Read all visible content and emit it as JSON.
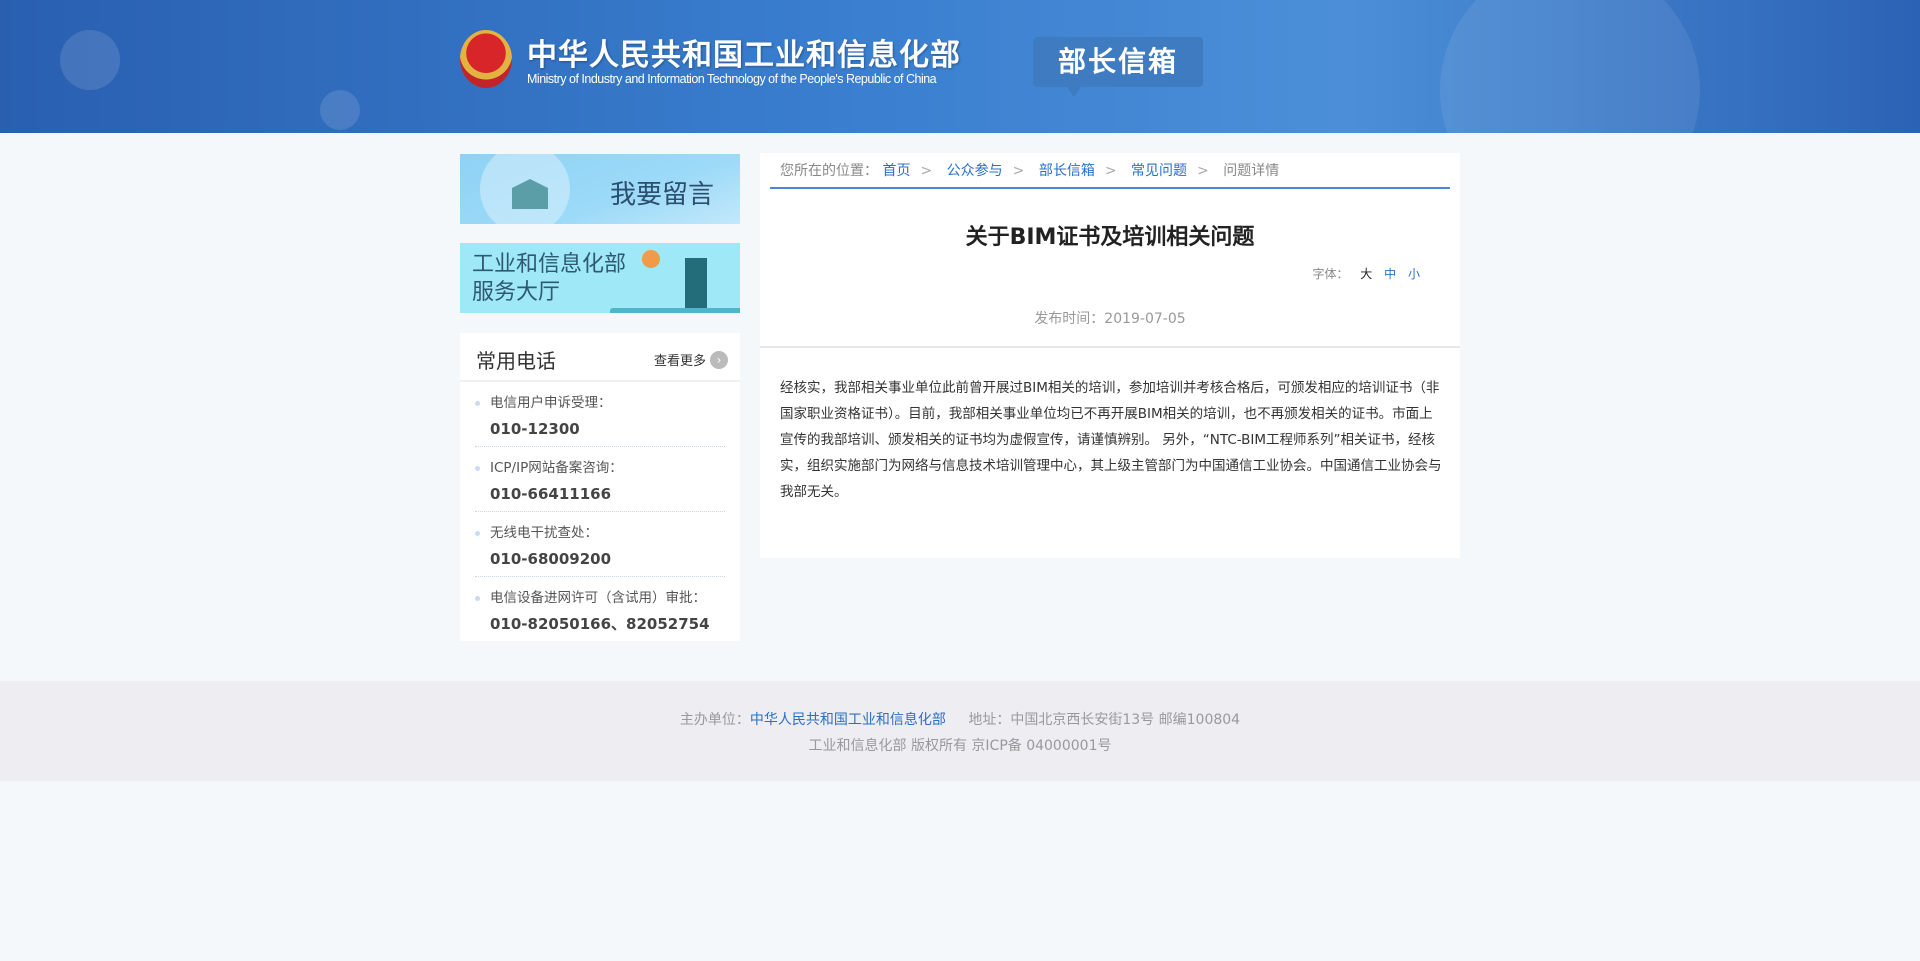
{
  "header": {
    "logo_cn": "中华人民共和国工业和信息化部",
    "logo_en": "Ministry of Industry and Information Technology of the People's Republic of China",
    "section_tag": "部长信箱"
  },
  "sidebar": {
    "banner_message": "我要留言",
    "banner_service_line1": "工业和信息化部",
    "banner_service_line2": "服务大厅",
    "phones": {
      "title": "常用电话",
      "more": "查看更多",
      "items": [
        {
          "label": "电信用户申诉受理：",
          "number": "010-12300"
        },
        {
          "label": "ICP/IP网站备案咨询：",
          "number": "010-66411166"
        },
        {
          "label": "无线电干扰查处：",
          "number": "010-68009200"
        },
        {
          "label": "电信设备进网许可（含试用）审批：",
          "number": "010-82050166、82052754"
        }
      ]
    }
  },
  "breadcrumb": {
    "prefix": "您所在的位置：",
    "items": [
      "首页",
      "公众参与",
      "部长信箱",
      "常见问题"
    ],
    "current": "问题详情",
    "separator": ">"
  },
  "article": {
    "title": "关于BIM证书及培训相关问题",
    "font_label": "字体：",
    "font_sizes": [
      "大",
      "中",
      "小"
    ],
    "date": "发布时间：2019-07-05",
    "body": "经核实，我部相关事业单位此前曾开展过BIM相关的培训，参加培训并考核合格后，可颁发相应的培训证书（非国家职业资格证书）。目前，我部相关事业单位均已不再开展BIM相关的培训，也不再颁发相关的证书。市面上宣传的我部培训、颁发相关的证书均为虚假宣传，请谨慎辨别。 另外，“NTC-BIM工程师系列”相关证书，经核实，组织实施部门为网络与信息技术培训管理中心，其上级主管部门为中国通信工业协会。中国通信工业协会与我部无关。"
  },
  "footer": {
    "host_label": "主办单位：",
    "host": "中华人民共和国工业和信息化部",
    "address": "地址：中国北京西长安街13号 邮编100804",
    "copyright": "工业和信息化部 版权所有 京ICP备 04000001号"
  }
}
